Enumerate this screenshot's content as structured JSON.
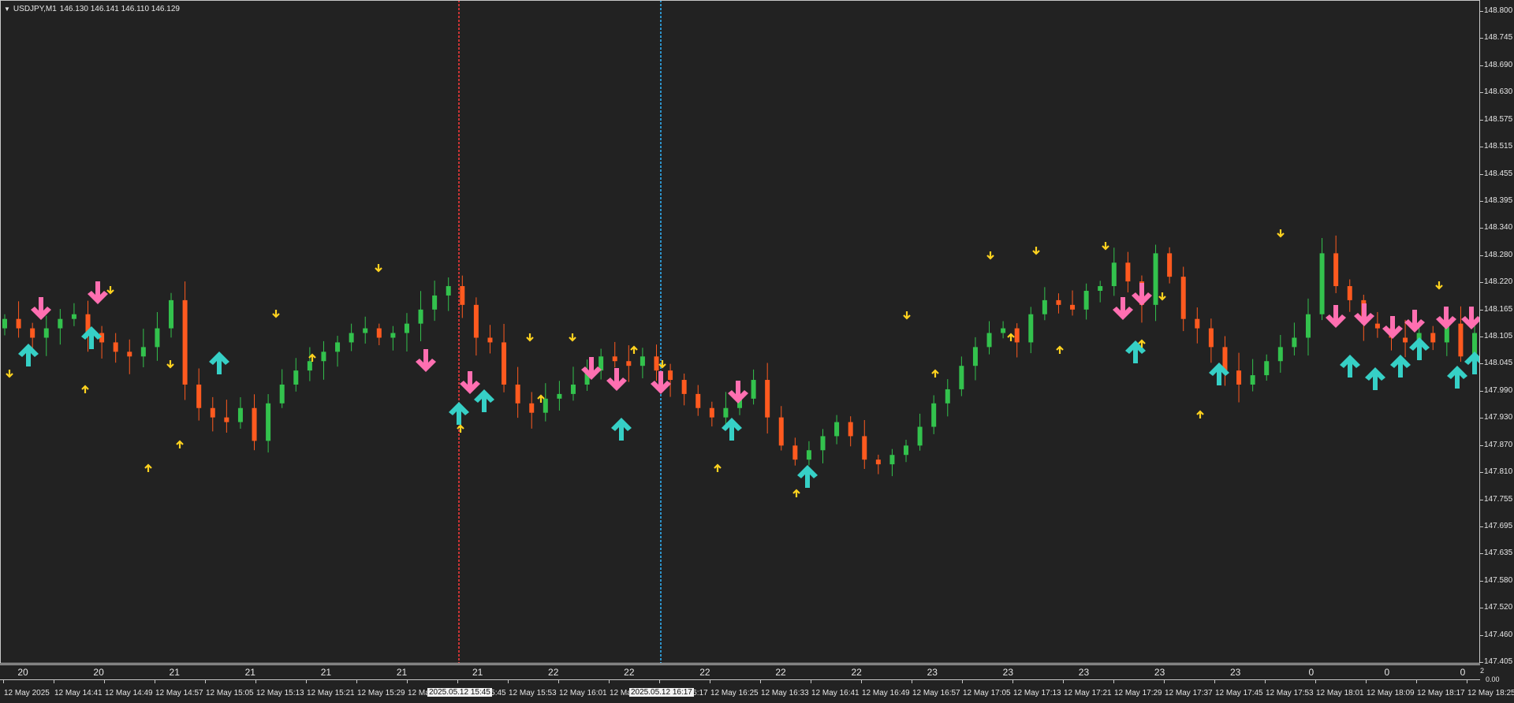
{
  "chart_header": {
    "symbol_timeframe": "USDJPY,M1",
    "ohlc": "146.130 146.141 146.110 146.129"
  },
  "colors": {
    "background": "#222222",
    "bull": "#33c24d",
    "bear": "#ff5a1f",
    "big_up_arrow": "#36d0c6",
    "big_down_arrow": "#ff6fb1",
    "small_arrow": "#ffd21f",
    "vline_red": "#ff3b3b",
    "vline_blue": "#31b6ff"
  },
  "price_axis": [
    "148.800",
    "148.745",
    "148.690",
    "148.630",
    "148.575",
    "148.515",
    "148.455",
    "148.395",
    "148.340",
    "148.280",
    "148.220",
    "148.165",
    "148.105",
    "148.045",
    "147.990",
    "147.930",
    "147.870",
    "147.810",
    "147.755",
    "147.695",
    "147.635",
    "147.580",
    "147.520",
    "147.460",
    "147.405"
  ],
  "indicator_numbers": [
    "20",
    "20",
    "21",
    "21",
    "21",
    "21",
    "21",
    "22",
    "22",
    "22",
    "22",
    "22",
    "23",
    "23",
    "23",
    "23",
    "23",
    "0",
    "0",
    "0"
  ],
  "time_axis": [
    "12 May 2025",
    "12 May 14:41",
    "12 May 14:49",
    "12 May 14:57",
    "12 May 15:05",
    "12 May 15:13",
    "12 May 15:21",
    "12 May 15:29",
    "12 May 15:37",
    "12 May 15:45",
    "12 May 15:53",
    "12 May 16:01",
    "12 May 16:09",
    "12 May 16:17",
    "12 May 16:25",
    "12 May 16:33",
    "12 May 16:41",
    "12 May 16:49",
    "12 May 16:57",
    "12 May 17:05",
    "12 May 17:13",
    "12 May 17:21",
    "12 May 17:29",
    "12 May 17:37",
    "12 May 17:45",
    "12 May 17:53",
    "12 May 18:01",
    "12 May 18:09",
    "12 May 18:17",
    "12 May 18:25"
  ],
  "vertical_lines": [
    {
      "label": "2025.05.12 15:45",
      "color": "red"
    },
    {
      "label": "2025.05.12 16:17",
      "color": "blue"
    }
  ],
  "corner_labels": {
    "top": "2",
    "bottom": "0.00"
  },
  "chart_data": {
    "type": "candlestick",
    "symbol": "USDJPY",
    "timeframe": "M1",
    "ylim": [
      147.405,
      148.8
    ],
    "series_close": [
      148.14,
      148.12,
      148.1,
      148.12,
      148.14,
      148.15,
      148.11,
      148.09,
      148.07,
      148.06,
      148.08,
      148.12,
      148.18,
      148.0,
      147.95,
      147.93,
      147.92,
      147.95,
      147.88,
      147.96,
      148.0,
      148.03,
      148.05,
      148.07,
      148.09,
      148.11,
      148.12,
      148.1,
      148.11,
      148.13,
      148.16,
      148.19,
      148.21,
      148.17,
      148.1,
      148.09,
      148.0,
      147.96,
      147.94,
      147.97,
      147.98,
      148.0,
      148.03,
      148.06,
      148.05,
      148.04,
      148.06,
      148.03,
      148.01,
      147.98,
      147.95,
      147.93,
      147.95,
      147.97,
      148.01,
      147.93,
      147.87,
      147.84,
      147.86,
      147.89,
      147.92,
      147.89,
      147.84,
      147.83,
      147.85,
      147.87,
      147.91,
      147.96,
      147.99,
      148.04,
      148.08,
      148.11,
      148.12,
      148.09,
      148.15,
      148.18,
      148.17,
      148.16,
      148.2,
      148.21,
      148.26,
      148.22,
      148.17,
      148.28,
      148.23,
      148.14,
      148.12,
      148.08,
      148.03,
      148.0,
      148.02,
      148.05,
      148.08,
      148.1,
      148.15,
      148.28,
      148.21,
      148.18,
      148.13,
      148.12,
      148.1,
      148.09,
      148.11,
      148.09,
      148.13,
      148.06,
      148.11
    ]
  }
}
